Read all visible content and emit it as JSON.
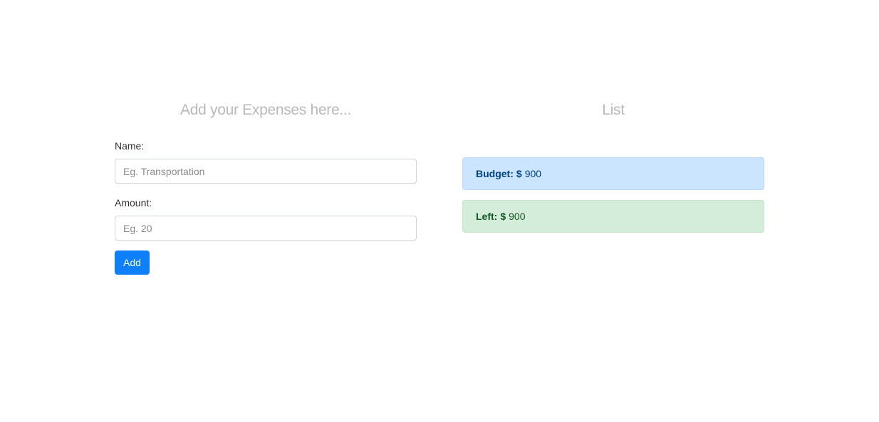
{
  "form": {
    "title": "Add your Expenses here...",
    "name_label": "Name:",
    "name_placeholder": "Eg. Transportation",
    "name_value": "",
    "amount_label": "Amount:",
    "amount_placeholder": "Eg. 20",
    "amount_value": "",
    "add_button_label": "Add"
  },
  "list": {
    "title": "List",
    "budget_label": "Budget:",
    "budget_currency": "$",
    "budget_value": "900",
    "left_label": "Left:",
    "left_currency": "$",
    "left_value": "900"
  },
  "colors": {
    "primary": "#0d7ff8",
    "budget_bg": "#cce5ff",
    "left_bg": "#d4edda"
  }
}
